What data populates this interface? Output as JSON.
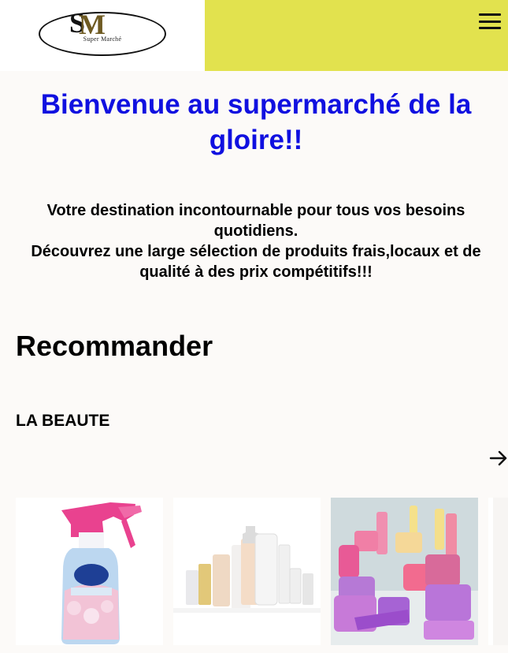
{
  "header": {
    "logo": {
      "mark_s": "S",
      "mark_m": "M",
      "text": "Super Marché"
    },
    "colors": {
      "accent": "#e2e24e",
      "logo_background": "#ffffff"
    },
    "menu_icon": "hamburger-menu-icon"
  },
  "hero": {
    "title": "Bienvenue au supermarché de la gloire!!",
    "intro_line1": "Votre destination incontournable pour tous vos besoins quotidiens.",
    "intro_line2": "Découvrez une large sélection de produits frais,locaux et de qualité à des prix compétitifs!!!",
    "title_color": "#1010e0"
  },
  "recommend": {
    "title": "Recommander",
    "category": "LA BEAUTE",
    "next_icon": "arrow-right-icon",
    "products": [
      {
        "image": "air-freshener-spray-bottle"
      },
      {
        "image": "skincare-bottles-set"
      },
      {
        "image": "cosmetic-jars-and-tubes"
      }
    ]
  }
}
